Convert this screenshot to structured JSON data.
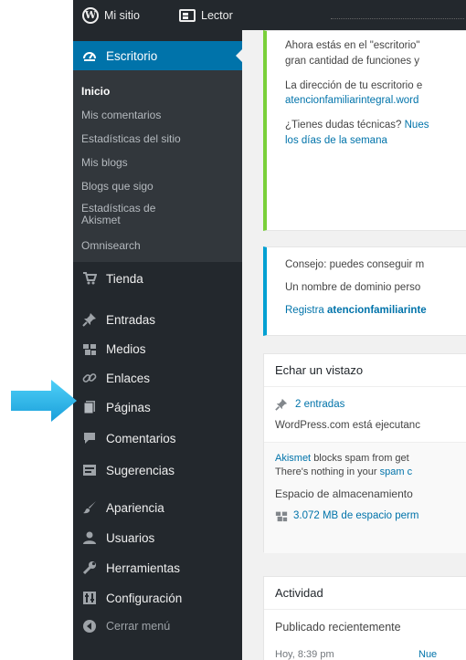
{
  "adminbar": {
    "site_label": "Mi sitio",
    "reader_label": "Lector"
  },
  "sidebar": {
    "current": "Escritorio",
    "submenu": [
      "Inicio",
      "Mis comentarios",
      "Estadísticas del sitio",
      "Mis blogs",
      "Blogs que sigo",
      "Estadísticas de",
      "Akismet",
      "Omnisearch"
    ],
    "items": [
      {
        "label": "Tienda",
        "icon": "cart-icon"
      },
      {
        "label": "Entradas",
        "icon": "pin-icon"
      },
      {
        "label": "Medios",
        "icon": "media-icon"
      },
      {
        "label": "Enlaces",
        "icon": "link-icon"
      },
      {
        "label": "Páginas",
        "icon": "page-icon"
      },
      {
        "label": "Comentarios",
        "icon": "comment-icon"
      },
      {
        "label": "Sugerencias",
        "icon": "feedback-icon"
      },
      {
        "label": "Apariencia",
        "icon": "brush-icon"
      },
      {
        "label": "Usuarios",
        "icon": "user-icon"
      },
      {
        "label": "Herramientas",
        "icon": "wrench-icon"
      },
      {
        "label": "Configuración",
        "icon": "settings-icon"
      },
      {
        "label": "Cerrar menú",
        "icon": "collapse-icon"
      }
    ]
  },
  "welcome": {
    "line1": "Ahora estás en el \"escritorio\"",
    "line2": "gran cantidad de funciones y",
    "line3": "La dirección de tu escritorio e",
    "line4": "atencionfamiliarintegral.word",
    "line5": "¿Tienes dudas técnicas?",
    "line5_link": "Nues",
    "line6": "los días de la semana"
  },
  "notice": {
    "line1": "Consejo: puedes conseguir m",
    "line2": "Un nombre de dominio perso",
    "link_prefix": "Registra",
    "link_bold": "atencionfamiliarinte"
  },
  "glance": {
    "title": "Echar un vistazo",
    "posts_link": "2 entradas",
    "running": "WordPress.com está ejecutanc",
    "akismet_link": "Akismet",
    "akismet_text": "blocks spam from get",
    "spam_line": "There's nothing in your",
    "spam_link": "spam c",
    "storage": "Espacio de almacenamiento",
    "storage_link": "3.072 MB de espacio perm"
  },
  "activity": {
    "title": "Actividad",
    "subtitle": "Publicado recientemente",
    "time": "Hoy, 8:39 pm",
    "link": "Nue"
  },
  "colors": {
    "sidebar_bg": "#23282d",
    "submenu_bg": "#32373c",
    "accent_blue": "#0073aa",
    "welcome_border": "#7ad03a",
    "notice_border": "#00a0d2",
    "arrow_cyan": "#29b6ec"
  }
}
